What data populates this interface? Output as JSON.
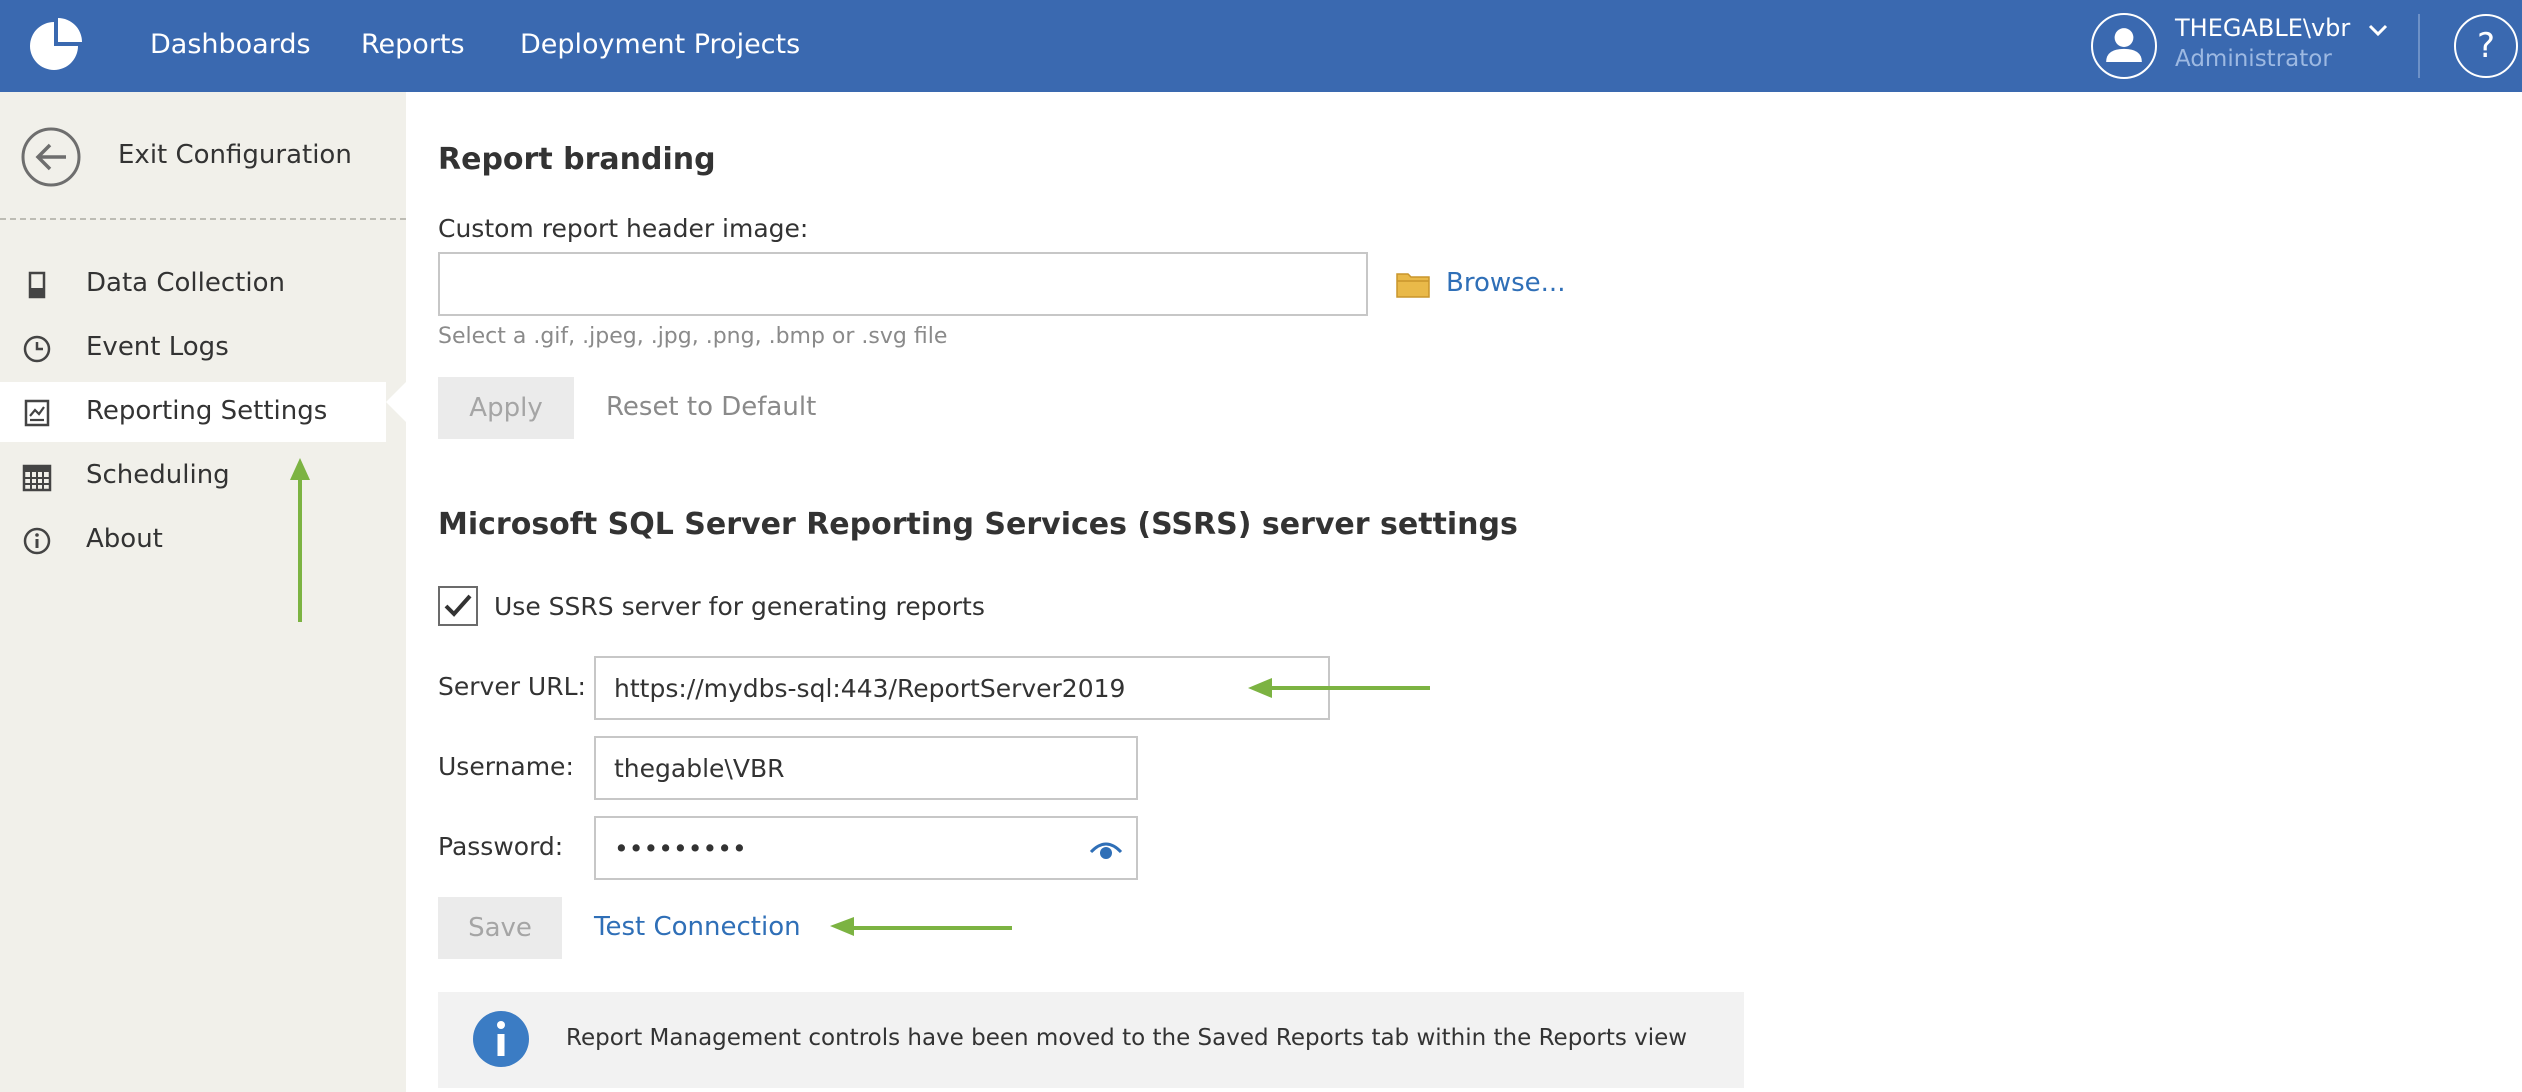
{
  "header": {
    "nav": [
      "Dashboards",
      "Reports",
      "Deployment Projects"
    ],
    "user_name": "THEGABLE\\vbr",
    "user_role": "Administrator",
    "help_label": "?",
    "icons": {
      "logo": "pie-chart-icon",
      "user": "user-icon",
      "menu": "chevron-down-icon"
    }
  },
  "sidebar": {
    "exit_label": "Exit Configuration",
    "items": [
      {
        "label": "Data Collection",
        "icon": "server-icon"
      },
      {
        "label": "Event Logs",
        "icon": "clock-icon"
      },
      {
        "label": "Reporting Settings",
        "icon": "chart-icon",
        "active": true
      },
      {
        "label": "Scheduling",
        "icon": "calendar-icon"
      },
      {
        "label": "About",
        "icon": "info-icon"
      }
    ]
  },
  "branding": {
    "title": "Report branding",
    "header_image_label": "Custom report header image:",
    "header_image_value": "",
    "browse_label": "Browse...",
    "hint": "Select a .gif, .jpeg, .jpg, .png, .bmp or .svg file",
    "apply_label": "Apply",
    "reset_label": "Reset to Default"
  },
  "ssrs": {
    "title": "Microsoft SQL Server Reporting Services (SSRS) server settings",
    "use_ssrs_label": "Use SSRS server for generating reports",
    "use_ssrs_checked": true,
    "server_url_label": "Server URL:",
    "server_url_value": "https://mydbs-sql:443/ReportServer2019",
    "username_label": "Username:",
    "username_value": "thegable\\VBR",
    "password_label": "Password:",
    "password_value": "•••••••••",
    "save_label": "Save",
    "test_connection_label": "Test Connection"
  },
  "info": {
    "message": "Report Management controls have been moved to the Saved Reports tab within the Reports view"
  },
  "colors": {
    "topbar": "#3a69b0",
    "sidebar": "#f1f0ea",
    "link": "#2f6fb7",
    "annotation_arrow": "#7cb342",
    "folder": "#e9b949"
  }
}
